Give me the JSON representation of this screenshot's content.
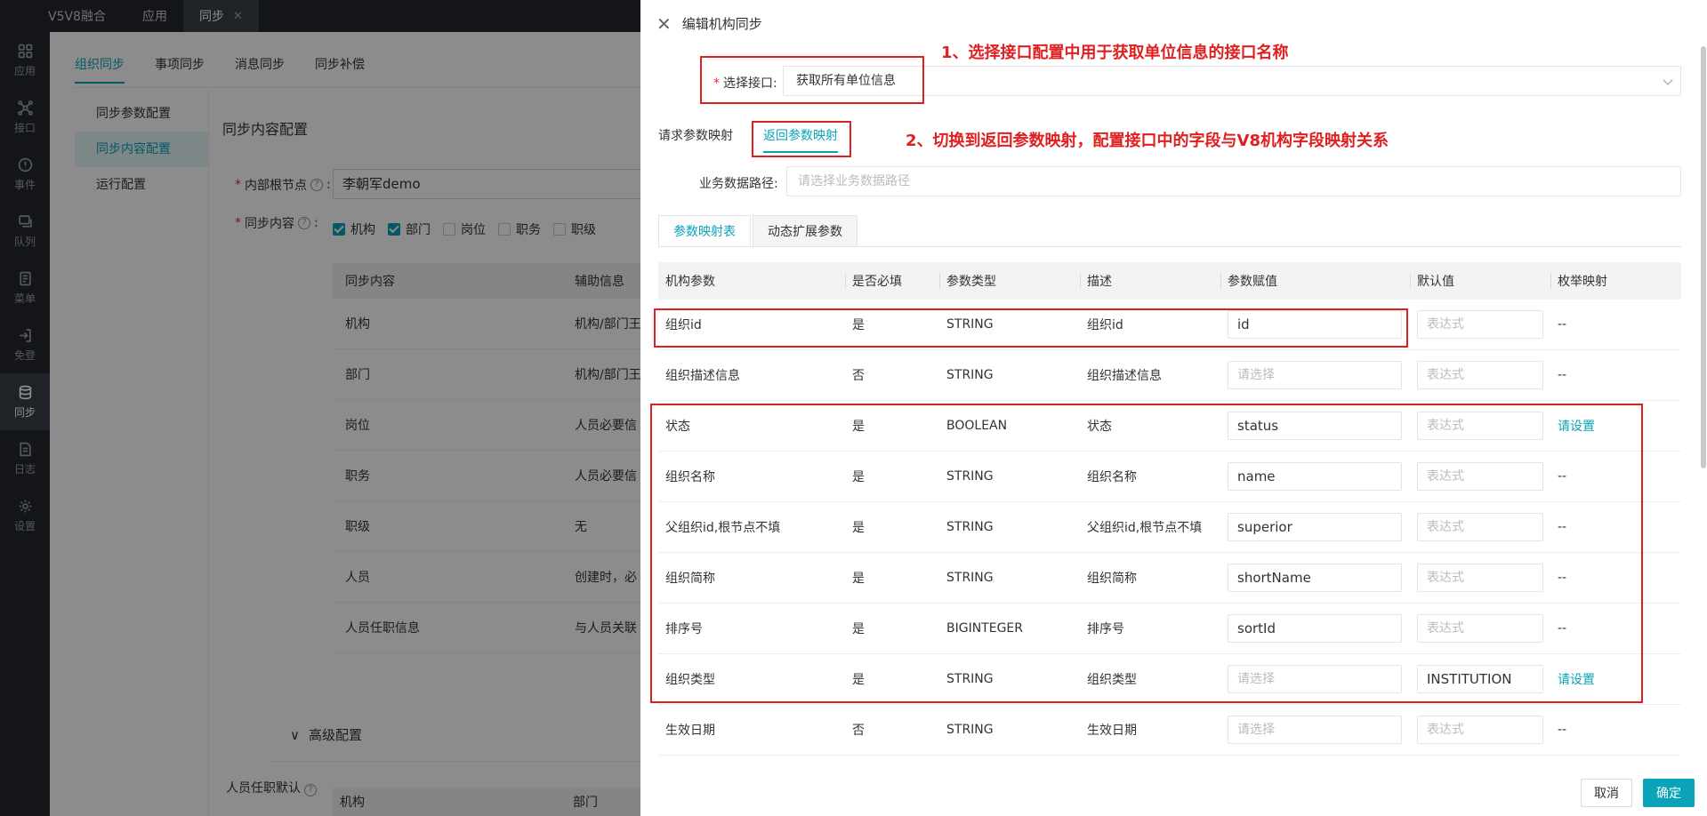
{
  "topbar": {
    "brand": "V5V8融合",
    "tabs": [
      {
        "label": "应用"
      },
      {
        "label": "同步"
      }
    ]
  },
  "leftnav": {
    "items": [
      {
        "label": "应用",
        "icon": "grid-icon"
      },
      {
        "label": "接口",
        "icon": "network-icon"
      },
      {
        "label": "事件",
        "icon": "alert-icon"
      },
      {
        "label": "队列",
        "icon": "queue-icon"
      },
      {
        "label": "菜单",
        "icon": "menu-doc-icon"
      },
      {
        "label": "免登",
        "icon": "login-icon"
      },
      {
        "label": "同步",
        "icon": "database-icon"
      },
      {
        "label": "日志",
        "icon": "log-icon"
      },
      {
        "label": "设置",
        "icon": "gear-icon"
      }
    ]
  },
  "page": {
    "tabs": [
      {
        "label": "组织同步"
      },
      {
        "label": "事项同步"
      },
      {
        "label": "消息同步"
      },
      {
        "label": "同步补偿"
      }
    ],
    "side_menu": [
      {
        "label": "同步参数配置"
      },
      {
        "label": "同步内容配置"
      },
      {
        "label": "运行配置"
      }
    ],
    "content_title": "同步内容配置",
    "root_label": "内部根节点",
    "root_value": "李朝军demo",
    "sync_label": "同步内容",
    "checkboxes": [
      {
        "label": "机构",
        "checked": true
      },
      {
        "label": "部门",
        "checked": true
      },
      {
        "label": "岗位",
        "checked": false
      },
      {
        "label": "职务",
        "checked": false
      },
      {
        "label": "职级",
        "checked": false
      }
    ],
    "table": {
      "headers": [
        "同步内容",
        "辅助信息"
      ],
      "rows": [
        [
          "机构",
          "机构/部门王"
        ],
        [
          "部门",
          "机构/部门王"
        ],
        [
          "岗位",
          "人员必要信"
        ],
        [
          "职务",
          "人员必要信"
        ],
        [
          "职级",
          "无"
        ],
        [
          "人员",
          "创建时，必"
        ],
        [
          "人员任职信息",
          "与人员关联"
        ]
      ]
    },
    "advanced_label": "高级配置",
    "bottom_label": "人员任职默认",
    "bottom_headers": [
      "机构",
      "部门"
    ]
  },
  "drawer": {
    "title": "编辑机构同步",
    "select_label": "选择接口:",
    "select_value": "获取所有单位信息",
    "sub_tabs": [
      {
        "label": "请求参数映射"
      },
      {
        "label": "返回参数映射"
      }
    ],
    "path_label": "业务数据路径:",
    "path_placeholder": "请选择业务数据路径",
    "card_tabs": [
      {
        "label": "参数映射表"
      },
      {
        "label": "动态扩展参数"
      }
    ],
    "grid": {
      "headers": [
        "机构参数",
        "是否必填",
        "参数类型",
        "描述",
        "参数赋值",
        "默认值",
        "枚举映射"
      ],
      "rows": [
        {
          "param": "组织id",
          "required": "是",
          "type": "STRING",
          "desc": "组织id",
          "assign": "id",
          "default": "表达式",
          "enum": "--",
          "assign_filled": true,
          "default_filled": false,
          "enum_link": false
        },
        {
          "param": "组织描述信息",
          "required": "否",
          "type": "STRING",
          "desc": "组织描述信息",
          "assign": "请选择",
          "default": "表达式",
          "enum": "--",
          "assign_filled": false,
          "default_filled": false,
          "enum_link": false
        },
        {
          "param": "状态",
          "required": "是",
          "type": "BOOLEAN",
          "desc": "状态",
          "assign": "status",
          "default": "表达式",
          "enum": "请设置",
          "assign_filled": true,
          "default_filled": false,
          "enum_link": true
        },
        {
          "param": "组织名称",
          "required": "是",
          "type": "STRING",
          "desc": "组织名称",
          "assign": "name",
          "default": "表达式",
          "enum": "--",
          "assign_filled": true,
          "default_filled": false,
          "enum_link": false
        },
        {
          "param": "父组织id,根节点不填",
          "required": "是",
          "type": "STRING",
          "desc": "父组织id,根节点不填",
          "assign": "superior",
          "default": "表达式",
          "enum": "--",
          "assign_filled": true,
          "default_filled": false,
          "enum_link": false
        },
        {
          "param": "组织简称",
          "required": "是",
          "type": "STRING",
          "desc": "组织简称",
          "assign": "shortName",
          "default": "表达式",
          "enum": "--",
          "assign_filled": true,
          "default_filled": false,
          "enum_link": false
        },
        {
          "param": "排序号",
          "required": "是",
          "type": "BIGINTEGER",
          "desc": "排序号",
          "assign": "sortId",
          "default": "表达式",
          "enum": "--",
          "assign_filled": true,
          "default_filled": false,
          "enum_link": false
        },
        {
          "param": "组织类型",
          "required": "是",
          "type": "STRING",
          "desc": "组织类型",
          "assign": "请选择",
          "default": "INSTITUTION",
          "enum": "请设置",
          "assign_filled": false,
          "default_filled": true,
          "enum_link": true
        },
        {
          "param": "生效日期",
          "required": "否",
          "type": "STRING",
          "desc": "生效日期",
          "assign": "请选择",
          "default": "表达式",
          "enum": "--",
          "assign_filled": false,
          "default_filled": false,
          "enum_link": false
        }
      ]
    },
    "cancel_label": "取消",
    "ok_label": "确定"
  },
  "annotations": {
    "note1": "1、选择接口配置中用于获取单位信息的接口名称",
    "note2": "2、切换到返回参数映射，配置接口中的字段与V8机构字段映射关系"
  },
  "colors": {
    "accent": "#0aa3b8",
    "annotation": "#e02020",
    "nav_bg": "#23272e"
  }
}
